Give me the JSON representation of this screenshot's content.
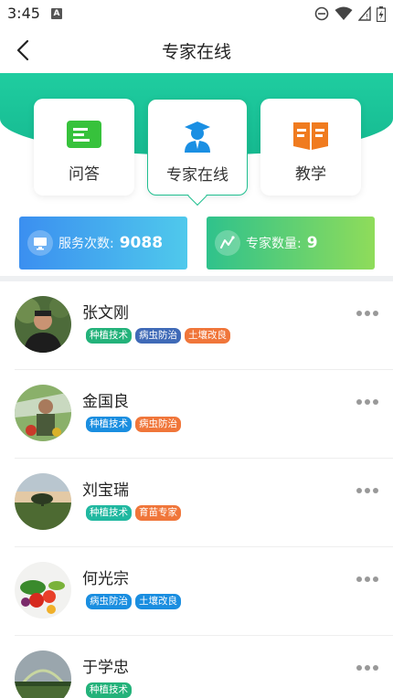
{
  "status_bar": {
    "time": "3:45",
    "a_badge": "A"
  },
  "header": {
    "title": "专家在线",
    "back_icon": "chevron-left-icon"
  },
  "tabs": [
    {
      "label": "问答",
      "icon": "qa-icon",
      "color": "#3cc13b",
      "active": false
    },
    {
      "label": "专家在线",
      "icon": "expert-icon",
      "color": "#1a8fe3",
      "active": true
    },
    {
      "label": "教学",
      "icon": "book-icon",
      "color": "#f07b1f",
      "active": false
    }
  ],
  "stats": [
    {
      "label": "服务次数:",
      "value": "9088",
      "icon": "monitor-icon",
      "gradient": [
        "#3b8ff0",
        "#4fc9ec"
      ]
    },
    {
      "label": "专家数量:",
      "value": "9",
      "icon": "chart-line-icon",
      "gradient": [
        "#2fc28c",
        "#8fdc5a"
      ]
    }
  ],
  "tag_colors": {
    "种植技术": "#23b27a",
    "病虫防治": "#3f6ab7",
    "土壤改良": "#f0763a",
    "育苗专家": "#f0763a"
  },
  "experts": [
    {
      "name": "张文刚",
      "tags": [
        {
          "text": "种植技术",
          "color": "#23b27a"
        },
        {
          "text": "病虫防治",
          "color": "#3f6ab7"
        },
        {
          "text": "土壤改良",
          "color": "#f0763a"
        }
      ],
      "avatar": "portrait-man"
    },
    {
      "name": "金国良",
      "tags": [
        {
          "text": "种植技术",
          "color": "#1a8ee0"
        },
        {
          "text": "病虫防治",
          "color": "#f0763a"
        }
      ],
      "avatar": "portrait-greenhouse"
    },
    {
      "name": "刘宝瑞",
      "tags": [
        {
          "text": "种植技术",
          "color": "#20b8a0"
        },
        {
          "text": "育苗专家",
          "color": "#f0763a"
        }
      ],
      "avatar": "landscape-tree"
    },
    {
      "name": "何光宗",
      "tags": [
        {
          "text": "病虫防治",
          "color": "#1a8ee0"
        },
        {
          "text": "土壤改良",
          "color": "#1a8ee0"
        }
      ],
      "avatar": "vegetables"
    },
    {
      "name": "于学忠",
      "tags": [
        {
          "text": "种植技术",
          "color": "#23b27a"
        }
      ],
      "avatar": "rainbow-field"
    }
  ]
}
